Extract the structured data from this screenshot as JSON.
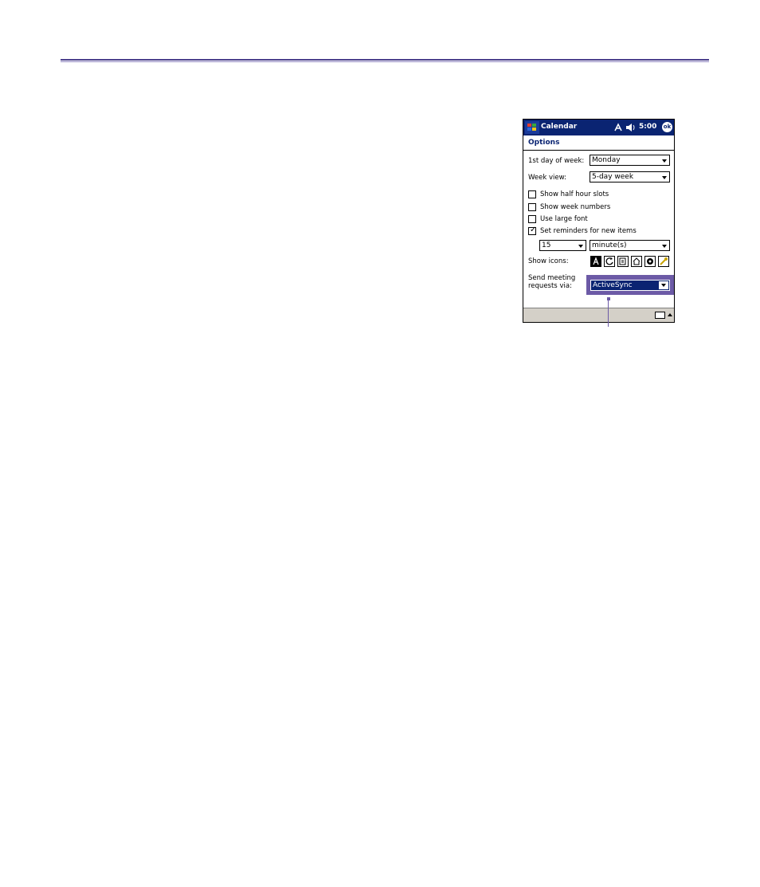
{
  "window": {
    "app_title": "Calendar",
    "clock": "5:00",
    "ok_label": "ok"
  },
  "options": {
    "header": "Options",
    "first_day_label": "1st day of week:",
    "first_day_value": "Monday",
    "week_view_label": "Week view:",
    "week_view_value": "5-day week",
    "checkboxes": [
      {
        "label": "Show half hour slots",
        "checked": false
      },
      {
        "label": "Show week numbers",
        "checked": false
      },
      {
        "label": "Use large font",
        "checked": false
      },
      {
        "label": "Set reminders for new items",
        "checked": true
      }
    ],
    "reminder_amount": "15",
    "reminder_unit": "minute(s)",
    "show_icons_label": "Show icons:",
    "send_meeting_label_line1": "Send meeting",
    "send_meeting_label_line2": "requests via:",
    "send_meeting_value": "ActiveSync"
  },
  "icons": [
    "start-menu-icon",
    "connectivity-icon",
    "volume-icon",
    "reminder-icon",
    "recurrence-icon",
    "note-icon",
    "home-icon",
    "private-icon",
    "meeting-icon",
    "keyboard-icon"
  ],
  "colors": {
    "title_bar": "#0a2472",
    "highlight": "#6c5aa6",
    "rule": "#4b3f8c"
  }
}
